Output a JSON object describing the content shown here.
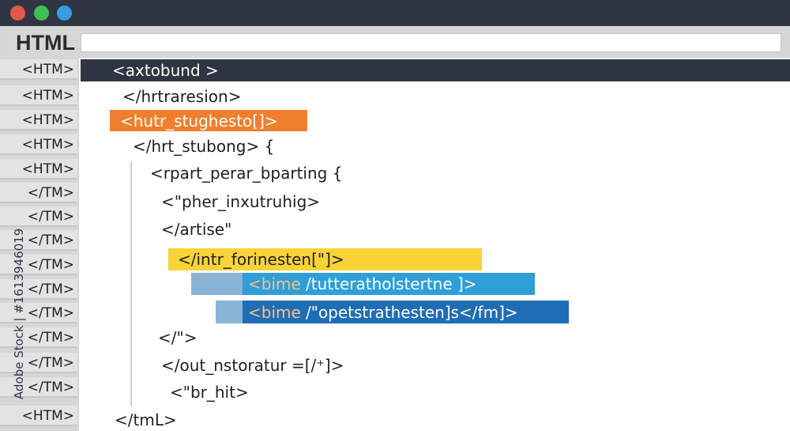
{
  "window": {
    "controls": [
      "close",
      "minimize",
      "zoom"
    ],
    "title": "HTML"
  },
  "gutter": {
    "labels": [
      "<HTM>",
      "<HTM>",
      "<HTM>",
      "<HTM>",
      "<HTM>",
      "</TM>",
      "</TM>",
      "</TM>",
      "</TM>",
      "</TM>",
      "</TM>",
      "</TM>",
      "</TM>",
      "</TM>",
      "<HTM>"
    ],
    "side_text": "Adobe Stock | #1613946019"
  },
  "code": {
    "line1": "<axtobund >",
    "line2": "</hrtraresion>",
    "line3": "<hutr_stughesto[]>",
    "line4": "</hrt_stubong> {",
    "line5": "<rpart_perar_bparting {",
    "line6": "<\"pher_inxutruhig>",
    "line7": "</artise\"",
    "line8": "</intr_forinesten[\"]>",
    "line9_tag": "<bime",
    "line9_rest": "/tutteratholstertne ]>",
    "line10_tag": "<bime",
    "line10_rest": "/\"opetstrathesten]s</fm]>",
    "line11": "</\">",
    "line12": "</out_nstoratur =[/⁺]>",
    "line13": "<\"br_hit>",
    "line14": "</tmL>"
  },
  "colors": {
    "titlebar": "#2f3542",
    "highlight_orange": "#f07f2d",
    "highlight_yellow": "#f8d337",
    "highlight_blue": "#2f9fd8",
    "highlight_dark_blue": "#1f6db5"
  }
}
